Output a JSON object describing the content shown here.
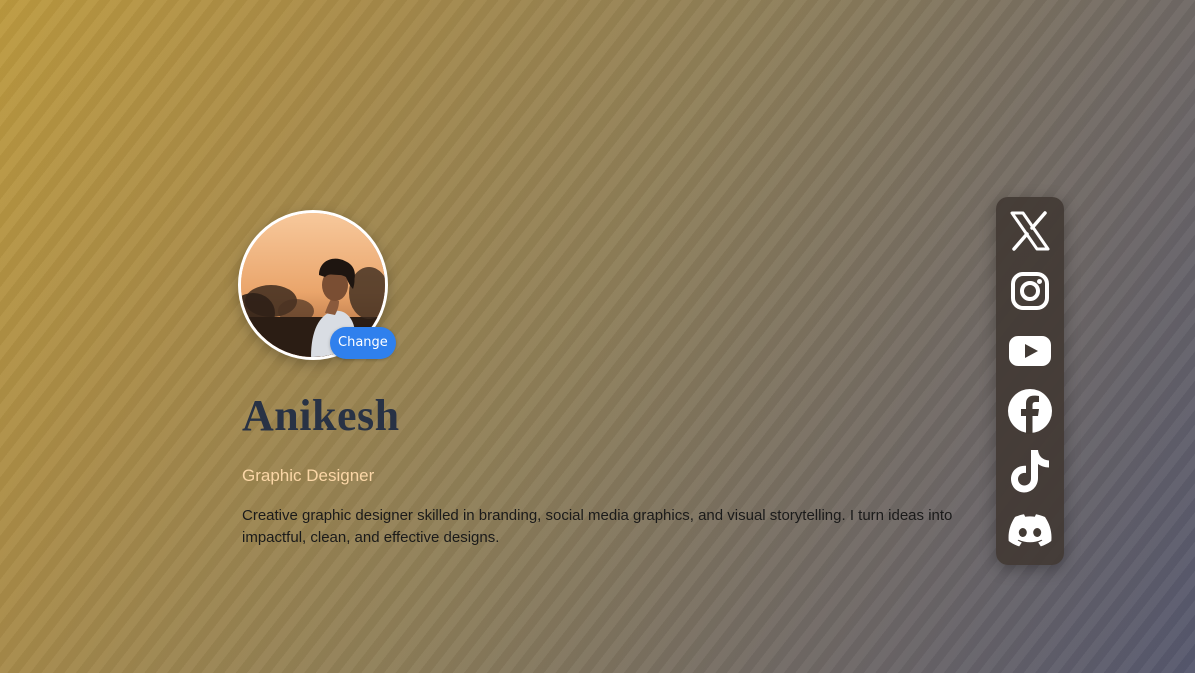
{
  "profile": {
    "name": "Anikesh",
    "role": "Graphic Designer",
    "bio": "Creative graphic designer skilled in branding, social media graphics, and visual storytelling. I turn ideas into impactful, clean, and effective designs.",
    "change_label": "Change"
  },
  "social": [
    {
      "icon": "x-icon",
      "platform": "X"
    },
    {
      "icon": "instagram-icon",
      "platform": "Instagram"
    },
    {
      "icon": "youtube-icon",
      "platform": "YouTube"
    },
    {
      "icon": "facebook-icon",
      "platform": "Facebook"
    },
    {
      "icon": "tiktok-icon",
      "platform": "TikTok"
    },
    {
      "icon": "discord-icon",
      "platform": "Discord"
    }
  ],
  "colors": {
    "accent": "#2f80ed",
    "name_text": "#283245",
    "role_text": "#fbd6a6",
    "social_bar": "#423a34"
  }
}
